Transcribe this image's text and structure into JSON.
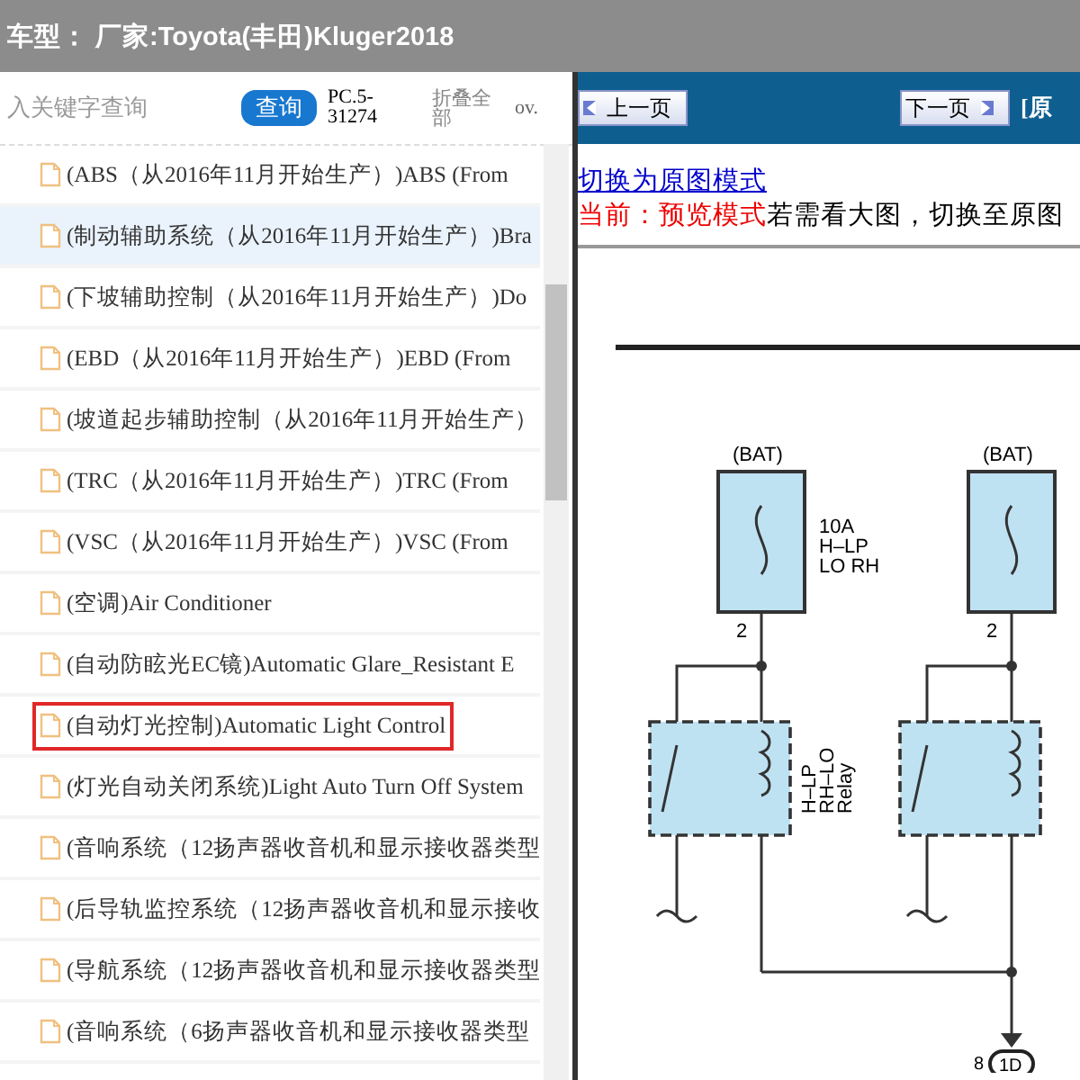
{
  "header": {
    "title": "车型： 厂家:Toyota(丰田)Kluger2018"
  },
  "search": {
    "placeholder": "入关键字查询",
    "button": "查询",
    "code": "PC.5-31274",
    "collapse": "折叠全部",
    "extra": "ov."
  },
  "items": [
    {
      "label": "(ABS（从2016年11月开始生产）)ABS (From",
      "selected": false,
      "highlighted": false
    },
    {
      "label": "(制动辅助系统（从2016年11月开始生产）)Bra",
      "selected": true,
      "highlighted": false
    },
    {
      "label": "(下坡辅助控制（从2016年11月开始生产）)Do",
      "selected": false,
      "highlighted": false
    },
    {
      "label": "(EBD（从2016年11月开始生产）)EBD (From",
      "selected": false,
      "highlighted": false
    },
    {
      "label": "(坡道起步辅助控制（从2016年11月开始生产）",
      "selected": false,
      "highlighted": false
    },
    {
      "label": "(TRC（从2016年11月开始生产）)TRC (From",
      "selected": false,
      "highlighted": false
    },
    {
      "label": "(VSC（从2016年11月开始生产）)VSC (From",
      "selected": false,
      "highlighted": false
    },
    {
      "label": "(空调)Air Conditioner",
      "selected": false,
      "highlighted": false
    },
    {
      "label": "(自动防眩光EC镜)Automatic Glare_Resistant E",
      "selected": false,
      "highlighted": false
    },
    {
      "label": "(自动灯光控制)Automatic Light Control",
      "selected": false,
      "highlighted": true
    },
    {
      "label": "(灯光自动关闭系统)Light Auto Turn Off System",
      "selected": false,
      "highlighted": false
    },
    {
      "label": "(音响系统（12扬声器收音机和显示接收器类型",
      "selected": false,
      "highlighted": false
    },
    {
      "label": "(后导轨监控系统（12扬声器收音机和显示接收",
      "selected": false,
      "highlighted": false
    },
    {
      "label": "(导航系统（12扬声器收音机和显示接收器类型",
      "selected": false,
      "highlighted": false
    },
    {
      "label": "(音响系统（6扬声器收音机和显示接收器类型",
      "selected": false,
      "highlighted": false
    }
  ],
  "viewer": {
    "prev": "上一页",
    "next": "下一页",
    "extra": "[原",
    "switch_link": "切换为原图模式",
    "mode_label": "当前：预览模式",
    "mode_hint": "若需看大图，切换至原图",
    "diagram": {
      "circuits": [
        {
          "source": "(BAT)",
          "fuse_lines": [
            "10A",
            "H–LP",
            "LO RH"
          ],
          "pin": "2",
          "relay_lines": [
            "H–LP",
            "RH–LO",
            "Relay"
          ]
        },
        {
          "source": "(BAT)",
          "pin": "2"
        }
      ],
      "connector": {
        "pin": "8",
        "name": "1D"
      }
    }
  }
}
